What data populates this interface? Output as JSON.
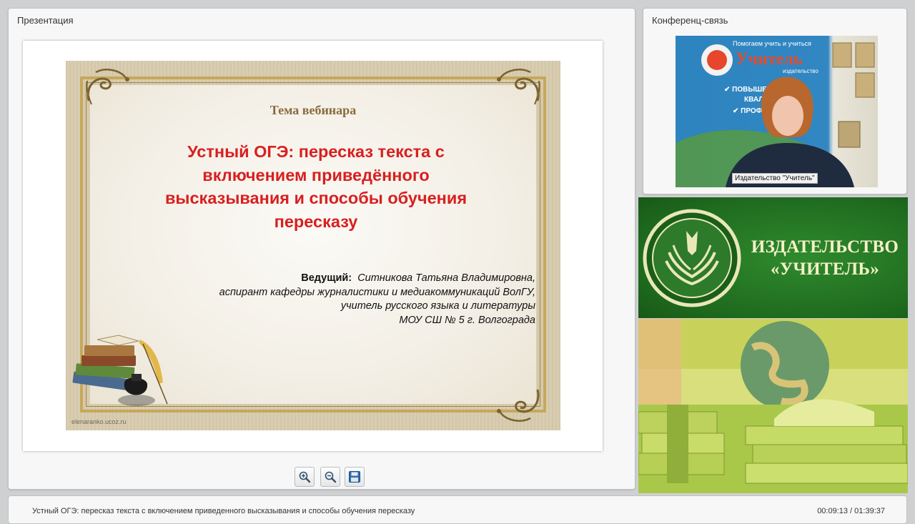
{
  "presentation_panel": {
    "title": "Презентация"
  },
  "slide": {
    "topic": "Тема вебинара",
    "heading_lines": [
      "Устный ОГЭ: пересказ текста с",
      "включением приведённого",
      "высказывания и способы обучения",
      "пересказу"
    ],
    "presenter_label": "Ведущий:",
    "presenter_lines": [
      "Ситникова Татьяна Владимировна,",
      "аспирант кафедры журналистики и медиакоммуникаций ВолГУ,",
      "учитель русского языка и литературы",
      "МОУ СШ № 5 г. Волгограда"
    ],
    "watermark": "elenaranko.ucoz.ru",
    "colors": {
      "heading": "#d91f1f",
      "topic": "#8a6a3c",
      "frame": "#c6a85c"
    }
  },
  "toolbar": {
    "zoom_in_icon": "zoom-in-icon",
    "zoom_out_icon": "zoom-out-icon",
    "save_icon": "floppy-disk-icon"
  },
  "conference_panel": {
    "title": "Конференц-связь",
    "video_caption": "Издательство \"Учитель\"",
    "poster_lines": [
      "Помогаем учить и учиться",
      "Учитель",
      "издательство",
      "ПОВЫШЕНИ",
      "КВАЛИ",
      "ПРОФЕ"
    ]
  },
  "publisher_banner": {
    "name_line1": "ИЗДАТЕЛЬСТВО",
    "name_line2": "«УЧИТЕЛЬ»",
    "colors": {
      "background": "#1f6b1f",
      "text": "#f4f1c8"
    }
  },
  "bottom_bar": {
    "title": "Устный ОГЭ: пересказ текста с включением приведенного высказывания и способы обучения пересказу",
    "time": "00:09:13 / 01:39:37"
  }
}
